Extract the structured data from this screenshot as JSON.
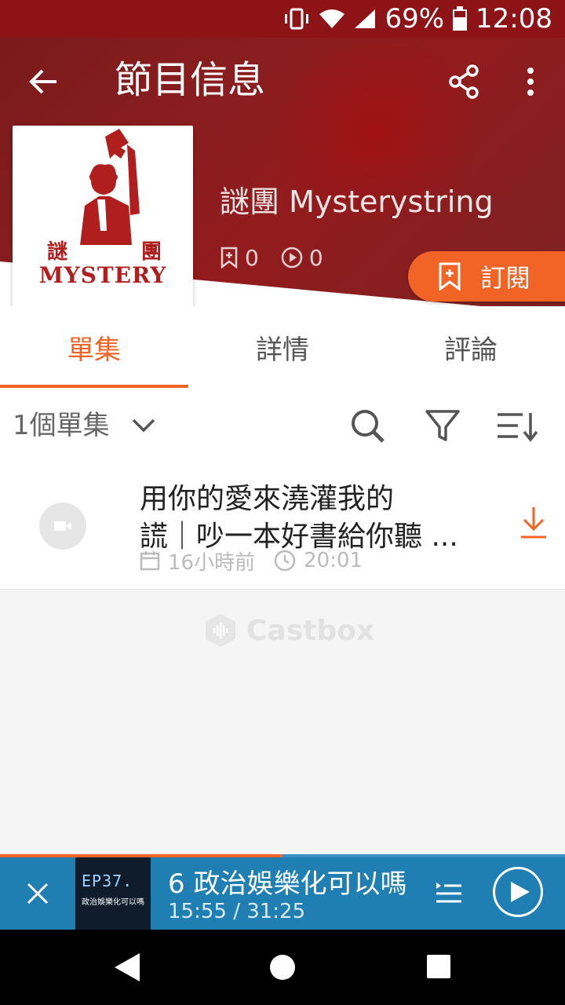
{
  "status_bar": {
    "battery": "69%",
    "time": "12:08"
  },
  "app_bar": {
    "title": "節目信息"
  },
  "podcast": {
    "cover_char_left": "謎",
    "cover_char_right": "團",
    "cover_text": "MYSTERY",
    "title": "謎團 Mysterystring",
    "subscribers": "0",
    "plays": "0"
  },
  "subscribe": {
    "label": "訂閱"
  },
  "tabs": [
    {
      "label": "單集",
      "active": true
    },
    {
      "label": "詳情",
      "active": false
    },
    {
      "label": "評論",
      "active": false
    }
  ],
  "list": {
    "count_label": "1個單集"
  },
  "episodes": [
    {
      "title_line1": "用你的愛來澆灌我的",
      "title_line2": "謊｜吵一本好書給你聽 ...",
      "date": "16小時前",
      "duration": "20:01"
    }
  ],
  "watermark": "Castbox",
  "player": {
    "cover_ep": "EP37.",
    "cover_sub": "政治娛樂化可以嗎",
    "title": "6 政治娛樂化可以嗎",
    "time": "15:55 / 31:25",
    "progress": 0.5
  },
  "colors": {
    "accent": "#f26426",
    "header": "#8e1316",
    "player": "#1f7fb3"
  }
}
